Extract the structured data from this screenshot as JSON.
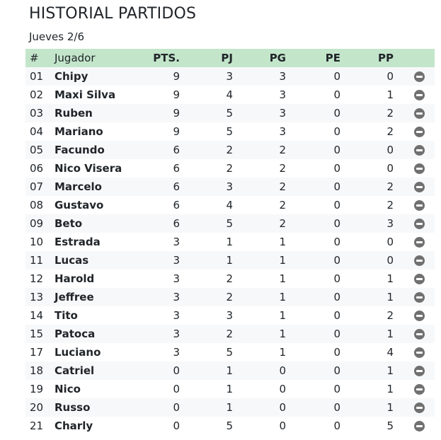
{
  "header": {
    "title": "HISTORIAL PARTIDOS",
    "subtitle": "Jueves 2/6"
  },
  "table": {
    "columns": [
      "#",
      "Jugador",
      "PTS.",
      "PJ",
      "PG",
      "PE",
      "PP"
    ],
    "rows": [
      {
        "idx": "01",
        "name": "Chipy",
        "pts": "9",
        "pj": "3",
        "pg": "3",
        "pe": "0",
        "pp": "0"
      },
      {
        "idx": "02",
        "name": "Maxi Silva",
        "pts": "9",
        "pj": "4",
        "pg": "3",
        "pe": "0",
        "pp": "1"
      },
      {
        "idx": "03",
        "name": "Ruben",
        "pts": "9",
        "pj": "5",
        "pg": "3",
        "pe": "0",
        "pp": "2"
      },
      {
        "idx": "04",
        "name": "Mariano",
        "pts": "9",
        "pj": "5",
        "pg": "3",
        "pe": "0",
        "pp": "2"
      },
      {
        "idx": "05",
        "name": "Facundo",
        "pts": "6",
        "pj": "2",
        "pg": "2",
        "pe": "0",
        "pp": "0"
      },
      {
        "idx": "06",
        "name": "Nico Visera",
        "pts": "6",
        "pj": "2",
        "pg": "2",
        "pe": "0",
        "pp": "0"
      },
      {
        "idx": "07",
        "name": "Marcelo",
        "pts": "6",
        "pj": "3",
        "pg": "2",
        "pe": "0",
        "pp": "2"
      },
      {
        "idx": "08",
        "name": "Gustavo",
        "pts": "6",
        "pj": "4",
        "pg": "2",
        "pe": "0",
        "pp": "2"
      },
      {
        "idx": "09",
        "name": "Beto",
        "pts": "6",
        "pj": "5",
        "pg": "2",
        "pe": "0",
        "pp": "3"
      },
      {
        "idx": "10",
        "name": "Estrada",
        "pts": "3",
        "pj": "1",
        "pg": "1",
        "pe": "0",
        "pp": "0"
      },
      {
        "idx": "11",
        "name": "Lucas",
        "pts": "3",
        "pj": "1",
        "pg": "1",
        "pe": "0",
        "pp": "0"
      },
      {
        "idx": "12",
        "name": "Harold",
        "pts": "3",
        "pj": "2",
        "pg": "1",
        "pe": "0",
        "pp": "1"
      },
      {
        "idx": "13",
        "name": "Jeffree",
        "pts": "3",
        "pj": "2",
        "pg": "1",
        "pe": "0",
        "pp": "1"
      },
      {
        "idx": "14",
        "name": "Tito",
        "pts": "3",
        "pj": "3",
        "pg": "1",
        "pe": "0",
        "pp": "2"
      },
      {
        "idx": "15",
        "name": "Patoca",
        "pts": "3",
        "pj": "2",
        "pg": "1",
        "pe": "0",
        "pp": "1"
      },
      {
        "idx": "17",
        "name": "Luciano",
        "pts": "3",
        "pj": "5",
        "pg": "1",
        "pe": "0",
        "pp": "4"
      },
      {
        "idx": "18",
        "name": "Catriel",
        "pts": "0",
        "pj": "1",
        "pg": "0",
        "pe": "0",
        "pp": "1"
      },
      {
        "idx": "19",
        "name": "Nico",
        "pts": "0",
        "pj": "1",
        "pg": "0",
        "pe": "0",
        "pp": "1"
      },
      {
        "idx": "20",
        "name": "Russo",
        "pts": "0",
        "pj": "1",
        "pg": "0",
        "pe": "0",
        "pp": "1"
      },
      {
        "idx": "21",
        "name": "Charly",
        "pts": "0",
        "pj": "5",
        "pg": "0",
        "pe": "0",
        "pp": "5"
      }
    ]
  },
  "icons": {
    "remove": "minus-circle-icon"
  },
  "colors": {
    "header_bg": "#c3e6cb",
    "stripe_bg": "#f7f8fa",
    "remove_icon": "#707070"
  }
}
